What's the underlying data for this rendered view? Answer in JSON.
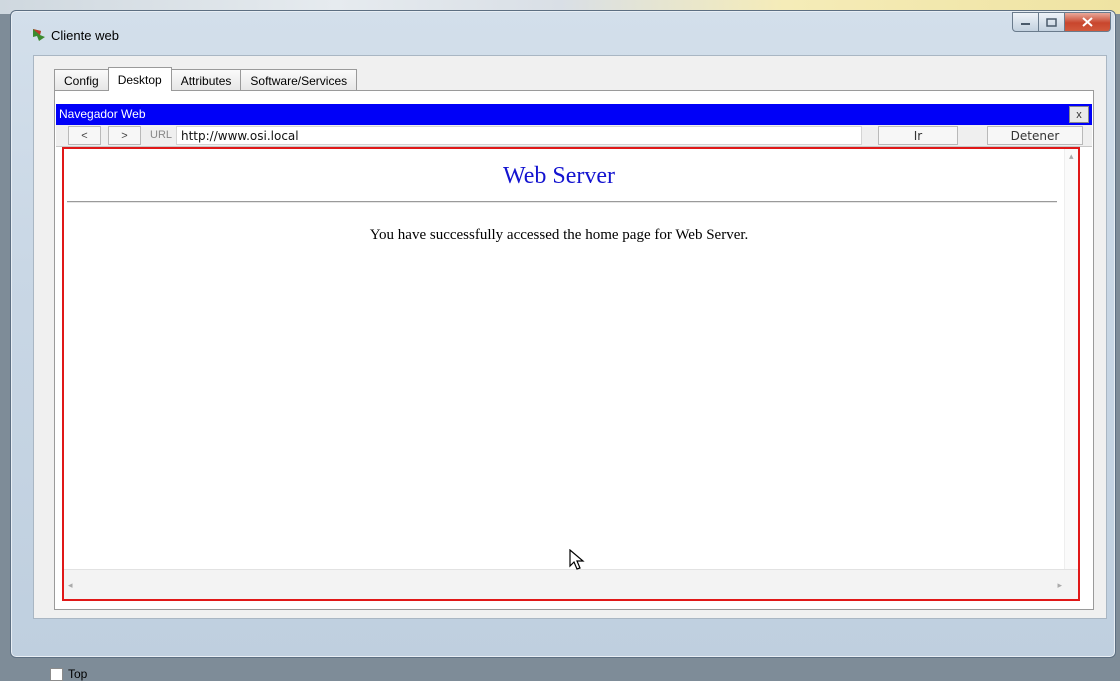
{
  "window": {
    "title": "Cliente web"
  },
  "tabs": [
    {
      "label": "Config"
    },
    {
      "label": "Desktop"
    },
    {
      "label": "Attributes"
    },
    {
      "label": "Software/Services"
    }
  ],
  "active_tab": "Desktop",
  "browser": {
    "title": "Navegador Web",
    "close_label": "x",
    "back_label": "<",
    "forward_label": ">",
    "url_label": "URL",
    "url_value": "http://www.osi.local",
    "go_label": "Ir",
    "stop_label": "Detener"
  },
  "page": {
    "heading": "Web Server",
    "body": "You have successfully accessed the home page for Web Server."
  },
  "footer": {
    "top_label": "Top"
  },
  "colors": {
    "browser_bar": "#0000f8",
    "heading": "#1414d0",
    "highlight_border": "#e01818"
  }
}
